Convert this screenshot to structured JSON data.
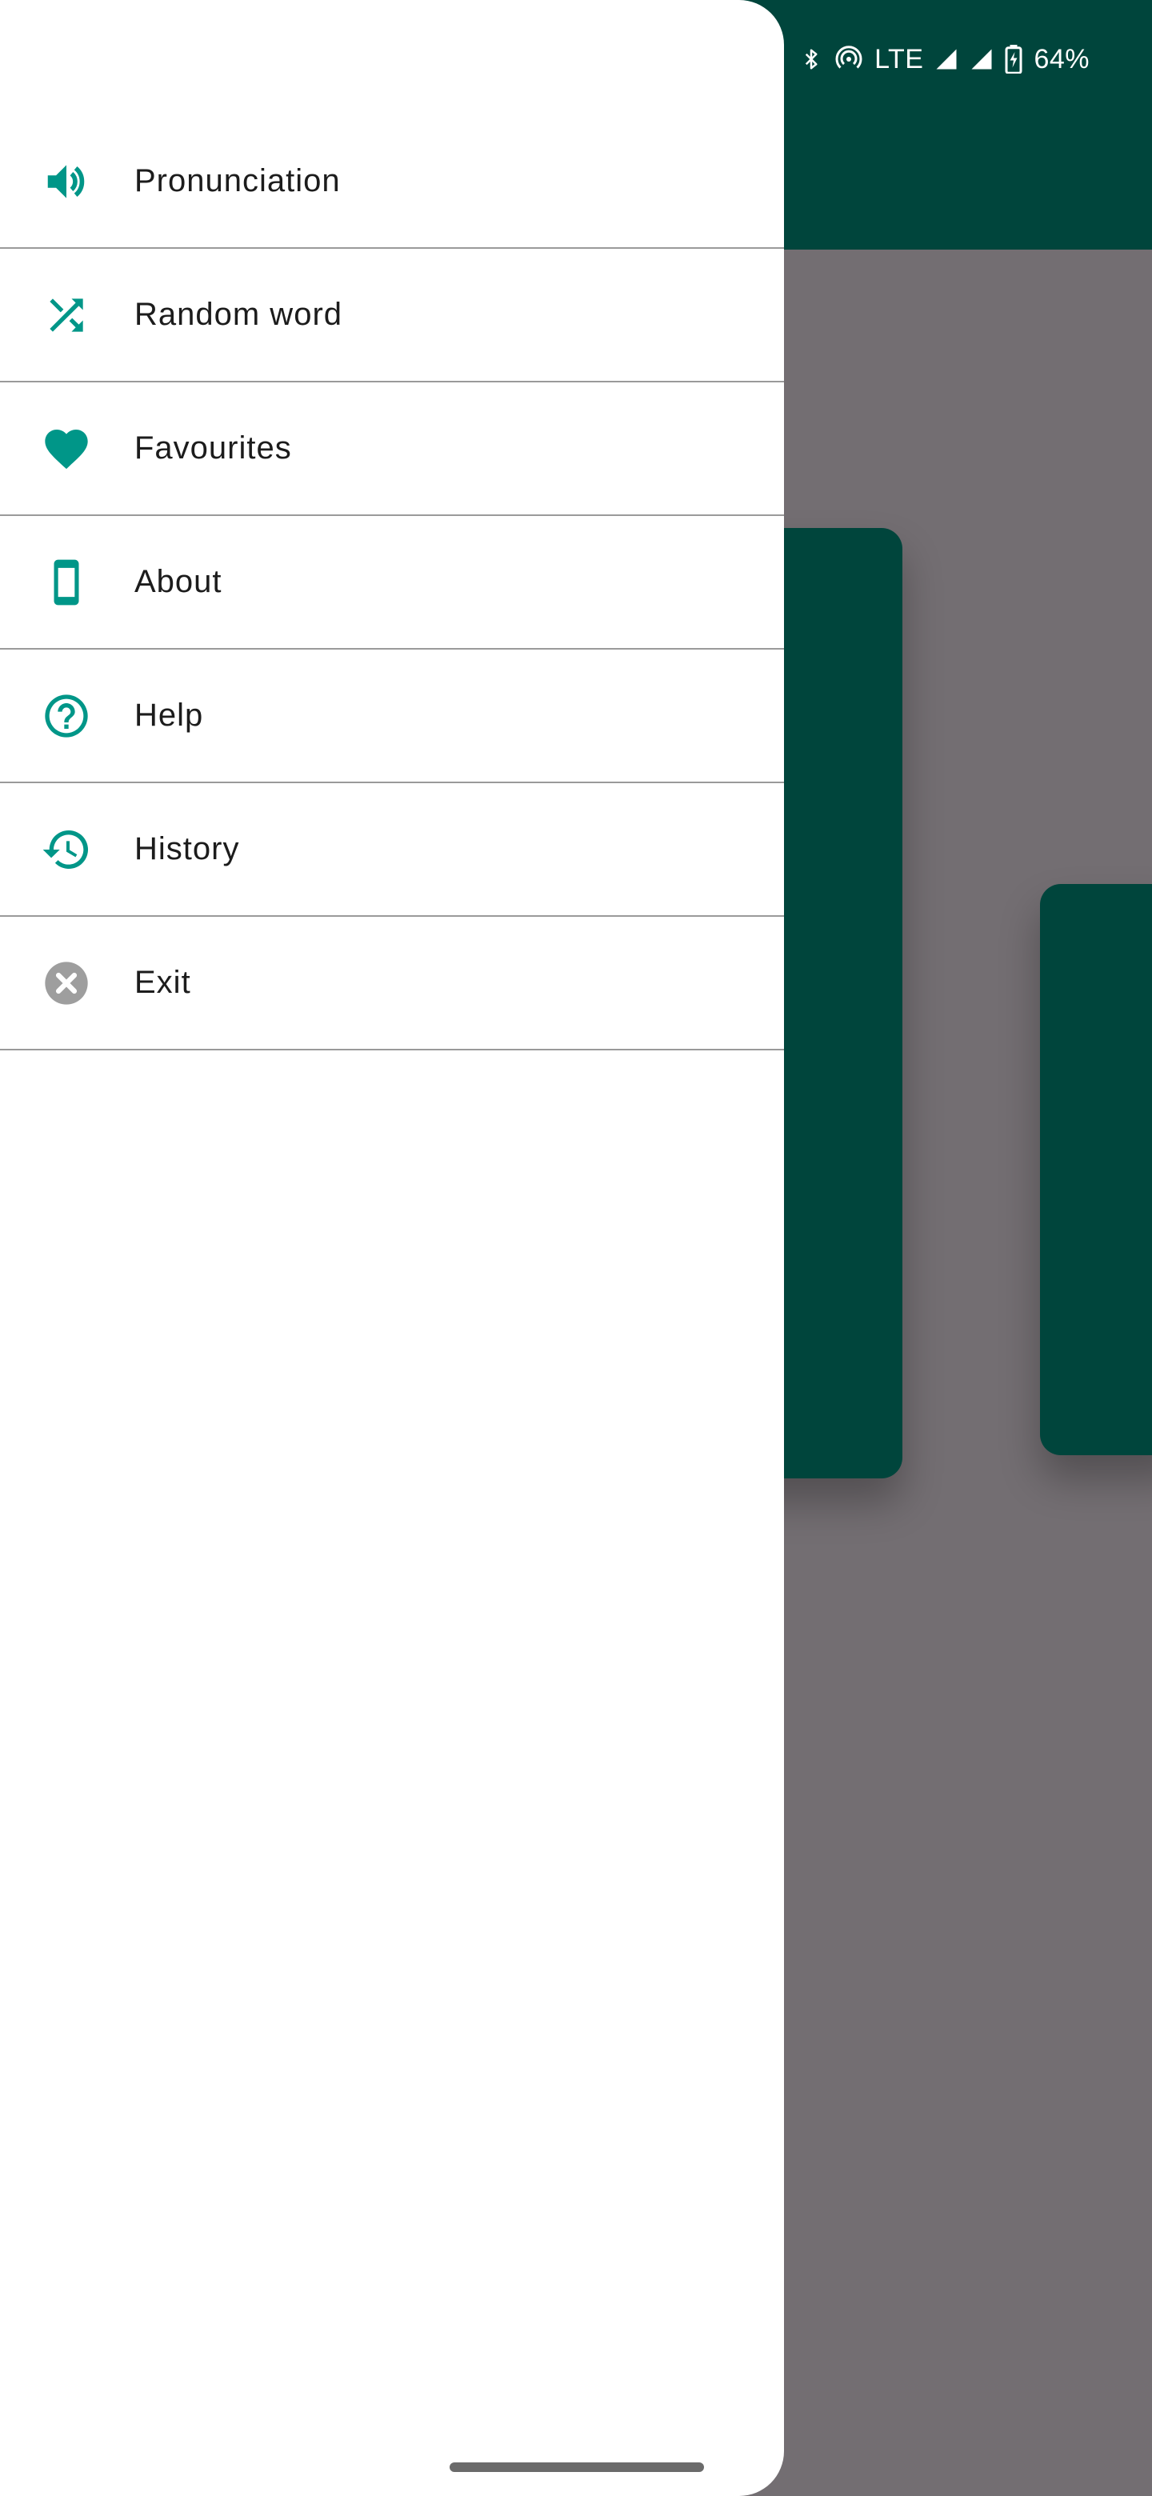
{
  "status_bar": {
    "network": "LTE",
    "battery": "64%"
  },
  "drawer": {
    "items": [
      {
        "label": "Pronunciation",
        "icon": "speaker-icon"
      },
      {
        "label": "Random word",
        "icon": "shuffle-icon"
      },
      {
        "label": "Favourites",
        "icon": "heart-icon"
      },
      {
        "label": "About",
        "icon": "phone-icon"
      },
      {
        "label": "Help",
        "icon": "help-circle-icon"
      },
      {
        "label": "History",
        "icon": "history-icon"
      },
      {
        "label": "Exit",
        "icon": "close-circle-icon"
      }
    ]
  },
  "colors": {
    "accent": "#009688",
    "app_bar": "#00453c",
    "scrim": "#736e72",
    "exit_icon": "#9e9e9e"
  }
}
